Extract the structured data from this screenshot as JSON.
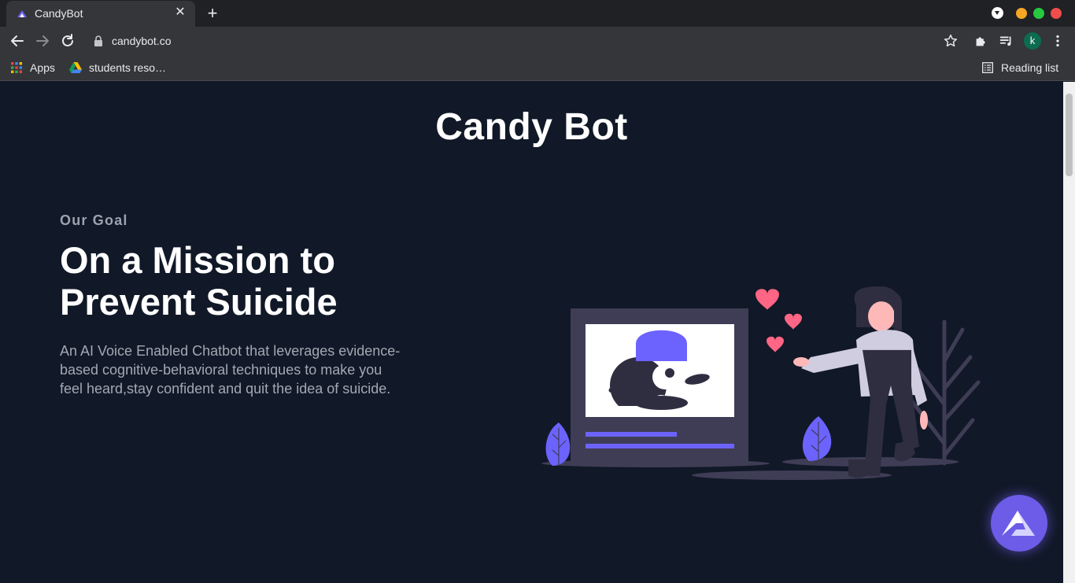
{
  "browser": {
    "tab_title": "CandyBot",
    "url": "candybot.co",
    "profile_initial": "k",
    "bookmarks": [
      {
        "label": "Apps",
        "icon": "apps-grid-icon"
      },
      {
        "label": "students reso…",
        "icon": "google-drive-icon"
      }
    ],
    "reading_list_label": "Reading list"
  },
  "page": {
    "site_title": "Candy Bot",
    "goal_label": "Our Goal",
    "headline": "On a Mission to Prevent Suicide",
    "description": "An AI Voice Enabled Chatbot that leverages evidence-based cognitive-behavioral techniques to make you feel heard,stay confident and quit the idea of suicide."
  },
  "colors": {
    "page_background": "#111827",
    "accent_purple": "#6c63ff",
    "heart_pink": "#ff6584",
    "fab_background": "#6c5ce7"
  }
}
